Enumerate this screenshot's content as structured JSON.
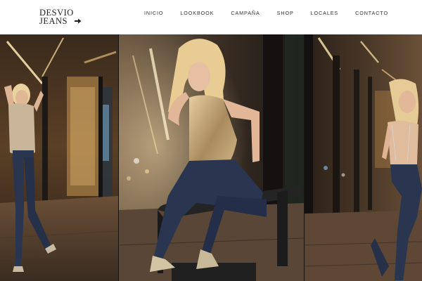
{
  "brand": {
    "line1": "DESVIO",
    "line2": "JEANS",
    "arrow_icon": "arrow-right-icon"
  },
  "nav": {
    "items": [
      "INICIO",
      "LOOKBOOK",
      "CAMPAÑA",
      "SHOP",
      "LOCALES",
      "CONTACTO"
    ]
  },
  "gallery": {
    "photos": [
      "photo-left: woman in sequin top and jeans posing in a lit subway station",
      "photo-center: woman in gold sequin top seated on a metal bench at night",
      "photo-right: woman in jeans and strappy top in a subway station"
    ]
  },
  "colors": {
    "header_bg": "#ffffff",
    "text": "#333333",
    "gold": "#c9a15c",
    "denim": "#2a3550"
  }
}
